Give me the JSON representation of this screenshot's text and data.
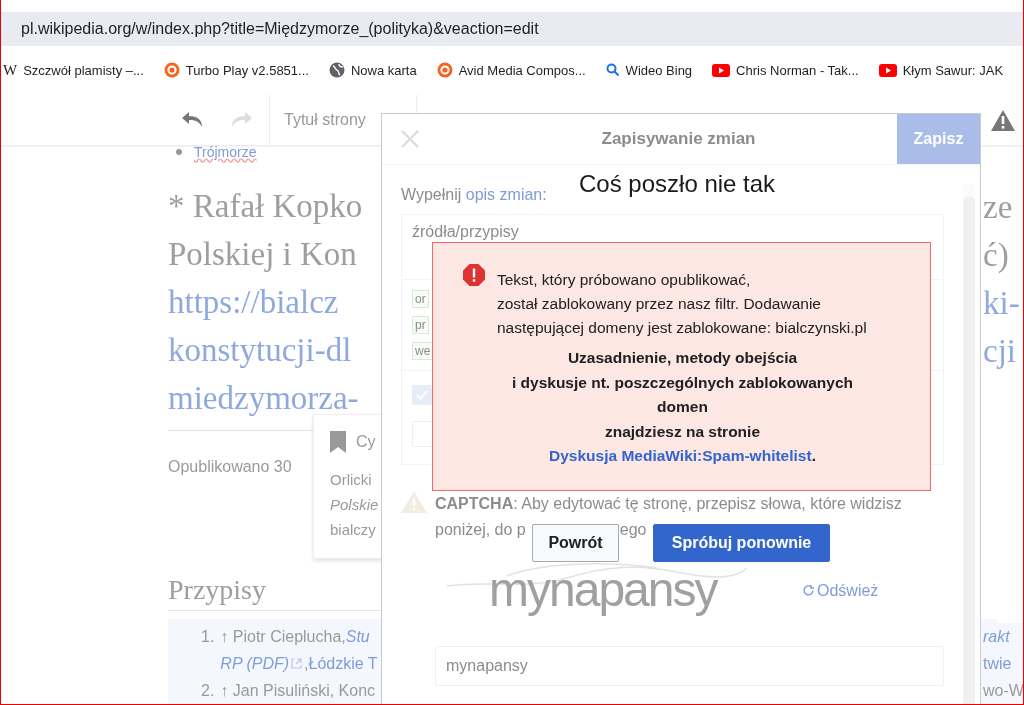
{
  "address_bar": {
    "url": "pl.wikipedia.org/w/index.php?title=Międzymorze_(polityka)&veaction=edit"
  },
  "bookmarks": [
    {
      "kind": "wiki",
      "glyph": "W",
      "label": "Szczwół plamisty –..."
    },
    {
      "kind": "gear",
      "label": "Turbo Play v2.5851..."
    },
    {
      "kind": "globe",
      "label": "Nowa karta"
    },
    {
      "kind": "gear",
      "label": "Avid Media Compos..."
    },
    {
      "kind": "search",
      "label": "Wideo Bing"
    },
    {
      "kind": "video",
      "label": "Chris Norman - Tak..."
    },
    {
      "kind": "video",
      "label": "Kłym Sawur: JAK"
    }
  ],
  "editor_toolbar": {
    "page_title": "Tytuł strony"
  },
  "article": {
    "bullet_link": "Trójmorze",
    "citation_lines": [
      {
        "text": "* Rafał Kopko",
        "kind": "text"
      },
      {
        "text": "Polskiej i Kon",
        "kind": "text"
      },
      {
        "text": "https://bialcz",
        "kind": "link"
      },
      {
        "text": "konstytucji-dl",
        "kind": "link"
      },
      {
        "text": "miedzymorza-",
        "kind": "link"
      }
    ],
    "published": "Opublikowano 30",
    "section_heading": "Przypisy",
    "references": [
      {
        "number": "1.",
        "lines": [
          [
            {
              "text": "↑ Piotr Cieplucha, ",
              "kind": "plain"
            },
            {
              "text": "Stu",
              "kind": "italic-link"
            }
          ],
          [
            {
              "text": "RP (PDF)",
              "kind": "italic-link"
            },
            {
              "text": ", ",
              "kind": "plain"
            },
            {
              "text": "Łódzkie T",
              "kind": "link"
            }
          ]
        ]
      },
      {
        "number": "2.",
        "lines": [
          [
            {
              "text": "↑ Jan Pisuliński, Konc",
              "kind": "plain"
            }
          ]
        ]
      }
    ],
    "right_heading_fragments": [
      "ze",
      "ć)",
      "ki-",
      "cji"
    ],
    "right_reference_fragments": [
      {
        "text": "rakt",
        "kind": "italic-link"
      },
      {
        "text": "twie",
        "kind": "link"
      },
      {
        "text": "wo-W",
        "kind": "plain"
      }
    ]
  },
  "citation_popup": {
    "title": "Cy",
    "lines": [
      {
        "text": "Orlicki",
        "kind": "plain"
      },
      {
        "text": "Polskie",
        "kind": "italic"
      },
      {
        "text": "bialczy",
        "kind": "plain"
      }
    ]
  },
  "save_dialog": {
    "title": "Zapisywanie zmian",
    "save_button": "Zapisz",
    "summary_prefix": "Wypełnij ",
    "summary_link": "opis zmian",
    "summary_suffix": ":",
    "summary_value": "źródła/przypisy",
    "tags": [
      "or",
      "pr",
      "we"
    ],
    "minor_checked": true,
    "captcha_line_1": "**CAPTCHA**: Aby edytować tę stronę, przepisz słowa, które widzisz",
    "captcha_line_2a": "poniżej, do p",
    "captcha_line_2b": "ego",
    "captcha_image_text": "mynapansy",
    "refresh": "Odśwież",
    "captcha_value": "mynapansy"
  },
  "error_dialog": {
    "title": "Coś poszło nie tak",
    "message_lines": [
      "Tekst, który próbowano opublikować,",
      "został zablokowany przez nasz filtr. Dodawanie",
      "następującej domeny jest zablokowane: bialczynski.pl"
    ],
    "bold_lines": [
      "Uzasadnienie, metody obejścia",
      "i dyskusje nt. poszczególnych zablokowanych",
      "domen",
      "znajdziesz na stronie"
    ],
    "link": "Dyskusja MediaWiki:Spam-whitelist",
    "link_suffix": ".",
    "buttons": [
      {
        "label": "Powrót",
        "kind": "secondary"
      },
      {
        "label": "Spróbuj ponownie",
        "kind": "primary"
      }
    ]
  }
}
